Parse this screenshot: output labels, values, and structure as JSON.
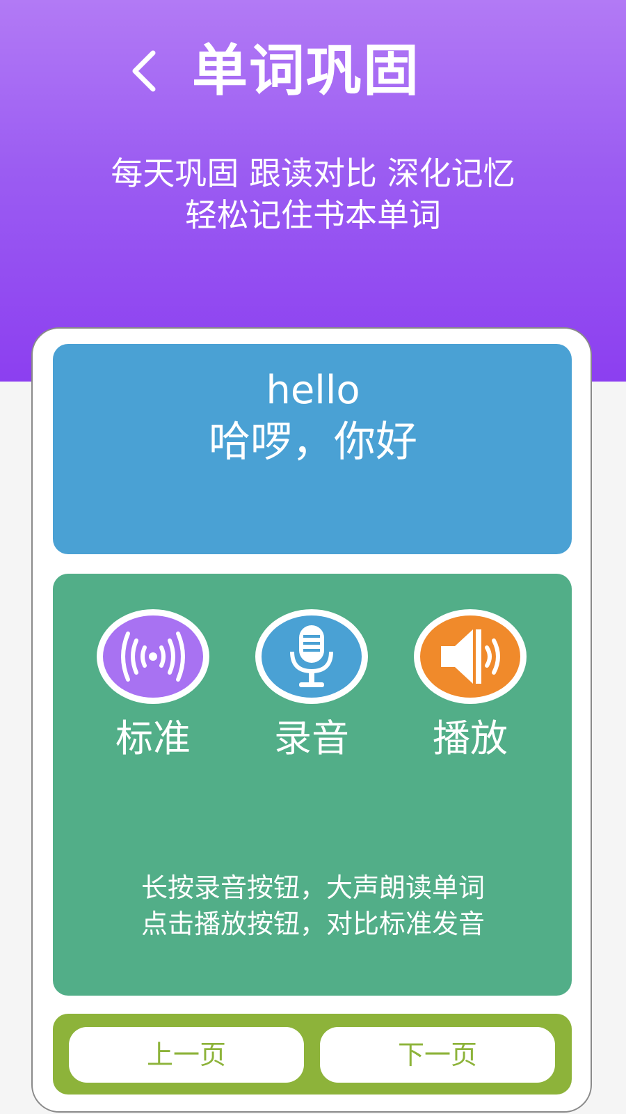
{
  "header": {
    "title": "单词巩固",
    "subtitle_line1": "每天巩固  跟读对比  深化记忆",
    "subtitle_line2": "轻松记住书本单词"
  },
  "word_card": {
    "word": "hello",
    "meaning": "哈啰，你好"
  },
  "practice": {
    "buttons": [
      {
        "label": "标准",
        "icon": "broadcast-icon",
        "color": "#a872f2"
      },
      {
        "label": "录音",
        "icon": "microphone-icon",
        "color": "#4aa1d4"
      },
      {
        "label": "播放",
        "icon": "speaker-icon",
        "color": "#f08a2b"
      }
    ],
    "tip_line1": "长按录音按钮，大声朗读单词",
    "tip_line2": "点击播放按钮，对比标准发音"
  },
  "navigation": {
    "prev_label": "上一页",
    "next_label": "下一页"
  },
  "colors": {
    "header_gradient_top": "#b27af5",
    "header_gradient_bottom": "#8c3ff0",
    "word_panel": "#4aa1d4",
    "practice_panel": "#52ae88",
    "nav_bar": "#8db33a"
  }
}
